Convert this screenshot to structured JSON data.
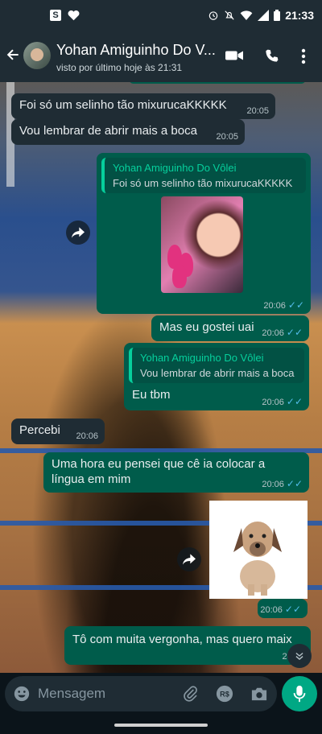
{
  "status_bar": {
    "time": "21:33"
  },
  "header": {
    "contact_name": "Yohan Amiguinho Do V...",
    "last_seen": "visto por último hoje às 21:31"
  },
  "messages": [
    {
      "text": "Foi só um selinho tão mixurucaKKKKK",
      "time": "20:05"
    },
    {
      "text": "Vou lembrar de abrir mais a boca",
      "time": "20:05"
    },
    {
      "quote_author": "Yohan Amiguinho Do Vôlei",
      "quote_text": "Foi só um selinho tão mixurucaKKKKK",
      "time": "20:06"
    },
    {
      "text": "Mas eu gostei uai",
      "time": "20:06"
    },
    {
      "quote_author": "Yohan Amiguinho Do Vôlei",
      "quote_text": "Vou lembrar de abrir mais a boca",
      "text": "Eu tbm",
      "time": "20:06"
    },
    {
      "text": "Percebi",
      "time": "20:06"
    },
    {
      "line1": "Uma hora eu pensei que cê ia colocar a",
      "line2": "língua em mim",
      "time": "20:06"
    },
    {
      "time": "20:06"
    },
    {
      "text": "Tô com muita vergonha, mas quero maix",
      "time": "20:07"
    }
  ],
  "composer": {
    "placeholder": "Mensagem"
  },
  "colors": {
    "incoming": "#1f2c34",
    "outgoing": "#005c4b",
    "accent": "#00a884",
    "read_ticks": "#53bdeb"
  },
  "icons": [
    "back-arrow-icon",
    "video-call-icon",
    "phone-icon",
    "menu-icon",
    "forward-icon",
    "emoji-icon",
    "attach-icon",
    "payment-icon",
    "camera-icon",
    "mic-icon",
    "scroll-down-icon"
  ]
}
